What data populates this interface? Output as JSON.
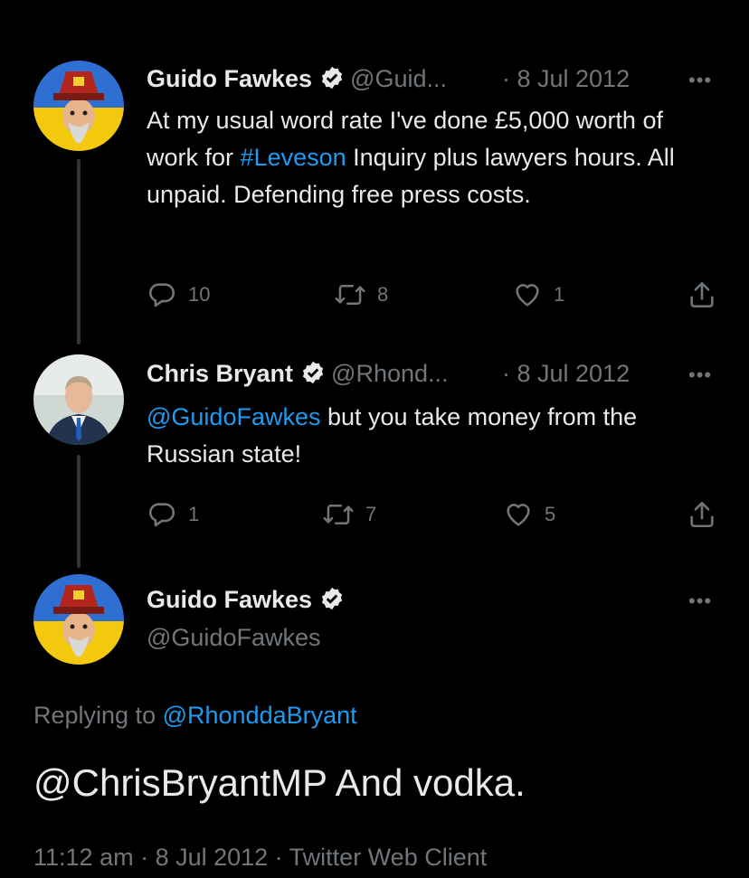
{
  "tweets": [
    {
      "name": "Guido Fawkes",
      "handle": "@Guid...",
      "date": "· 8 Jul 2012",
      "text_before": "At my usual word rate I've done £5,000 worth of work for ",
      "hashtag": "#Leveson",
      "text_after": " Inquiry plus lawyers hours. All unpaid. Defending free press costs.",
      "replies": "10",
      "retweets": "8",
      "likes": "1"
    },
    {
      "name": "Chris Bryant",
      "handle": "@Rhond...",
      "date": "· 8 Jul 2012",
      "mention": "@GuidoFawkes",
      "text_after": " but you take money from the Russian state!",
      "replies": "1",
      "retweets": "7",
      "likes": "5"
    }
  ],
  "main_tweet": {
    "name": "Guido Fawkes",
    "handle": "@GuidoFawkes",
    "replying_label": "Replying to ",
    "replying_to": "@RhonddaBryant",
    "text": "@ChrisBryantMP And vodka.",
    "timestamp": "11:12 am · 8 Jul 2012 · Twitter Web Client"
  },
  "more_label": "•••",
  "colors": {
    "background": "#000000",
    "link": "#1d9bf0",
    "muted": "#71767b"
  }
}
